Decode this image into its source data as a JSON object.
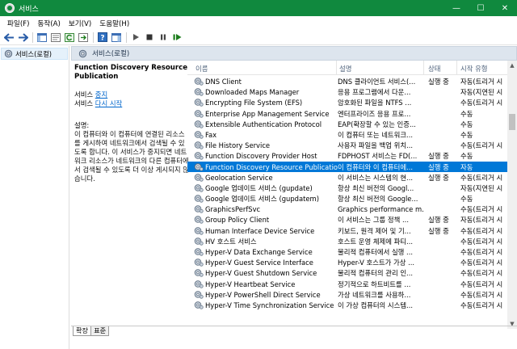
{
  "window": {
    "title": "서비스",
    "minimize": "—",
    "maximize": "☐",
    "close": "✕"
  },
  "menu": [
    "파일(F)",
    "동작(A)",
    "보기(V)",
    "도움말(H)"
  ],
  "tree": {
    "label": "서비스(로컬)"
  },
  "panel_header": "서비스(로컬)",
  "detail": {
    "title": "Function Discovery Resource Publication",
    "link_prefix_1": "서비스 ",
    "link_1": "중지",
    "link_prefix_2": "서비스 ",
    "link_2": "다시 시작",
    "desc_label": "설명:",
    "desc_text": "이 컴퓨터와 이 컴퓨터에 연결된 리소스를 게시하여 네트워크에서 검색될 수 있도록 합니다. 이 서비스가 중지되면 네트워크 리소스가 네트워크의 다른 컴퓨터에서 검색될 수 있도록 더 이상 게시되지 않습니다."
  },
  "columns": {
    "name": "이름",
    "desc": "설명",
    "status": "상태",
    "startup": "시작 유형"
  },
  "rows": [
    {
      "name": "DNS Client",
      "desc": "DNS 클라이언트 서비스(...",
      "status": "실행 중",
      "startup": "자동(트리거 시"
    },
    {
      "name": "Downloaded Maps Manager",
      "desc": "응용 프로그램에서 다운...",
      "status": "",
      "startup": "자동(지연된 시"
    },
    {
      "name": "Encrypting File System (EFS)",
      "desc": "암호화된 파일을 NTFS ...",
      "status": "",
      "startup": "수동(트리거 시"
    },
    {
      "name": "Enterprise App Management Service",
      "desc": "엔터프라이즈 응용 프로...",
      "status": "",
      "startup": "수동"
    },
    {
      "name": "Extensible Authentication Protocol",
      "desc": "EAP(확장할 수 있는 인증...",
      "status": "",
      "startup": "수동"
    },
    {
      "name": "Fax",
      "desc": "이 컴퓨터 또는 네트워크...",
      "status": "",
      "startup": "수동"
    },
    {
      "name": "File History Service",
      "desc": "사용자 파일을 백업 위치...",
      "status": "",
      "startup": "수동(트리거 시"
    },
    {
      "name": "Function Discovery Provider Host",
      "desc": "FDPHOST 서비스는 FD(...",
      "status": "실행 중",
      "startup": "수동"
    },
    {
      "name": "Function Discovery Resource Publication",
      "desc": "이 컴퓨터와 이 컴퓨터에...",
      "status": "실행 중",
      "startup": "자동"
    },
    {
      "name": "Geolocation Service",
      "desc": "이 서비스는 시스템의 현...",
      "status": "실행 중",
      "startup": "수동(트리거 시"
    },
    {
      "name": "Google 업데이트 서비스 (gupdate)",
      "desc": "항상 최신 버전의 Googl...",
      "status": "",
      "startup": "자동(지연된 시"
    },
    {
      "name": "Google 업데이트 서비스 (gupdatem)",
      "desc": "항상 최신 버전의 Google...",
      "status": "",
      "startup": "수동"
    },
    {
      "name": "GraphicsPerfSvc",
      "desc": "Graphics performance m...",
      "status": "",
      "startup": "수동(트리거 시"
    },
    {
      "name": "Group Policy Client",
      "desc": "이 서비스는 그룹 정책 ...",
      "status": "실행 중",
      "startup": "자동(트리거 시"
    },
    {
      "name": "Human Interface Device Service",
      "desc": "키보드, 원격 제어 및 기...",
      "status": "실행 중",
      "startup": "수동(트리거 시"
    },
    {
      "name": "HV 호스트 서비스",
      "desc": "호스트 운영 체제에 파티...",
      "status": "",
      "startup": "수동(트리거 시"
    },
    {
      "name": "Hyper-V Data Exchange Service",
      "desc": "물리적 컴퓨터에서 실행 ...",
      "status": "",
      "startup": "수동(트리거 시"
    },
    {
      "name": "Hyper-V Guest Service Interface",
      "desc": "Hyper-V 호스트가 가상 ...",
      "status": "",
      "startup": "수동(트리거 시"
    },
    {
      "name": "Hyper-V Guest Shutdown Service",
      "desc": "물리적 컴퓨터의 관리 인...",
      "status": "",
      "startup": "수동(트리거 시"
    },
    {
      "name": "Hyper-V Heartbeat Service",
      "desc": "정기적으로 하트비트를 ...",
      "status": "",
      "startup": "수동(트리거 시"
    },
    {
      "name": "Hyper-V PowerShell Direct Service",
      "desc": "가상 네트워크를 사용하...",
      "status": "",
      "startup": "수동(트리거 시"
    },
    {
      "name": "Hyper-V Time Synchronization Service",
      "desc": "이 가상 컴퓨터의 시스템...",
      "status": "",
      "startup": "수동(트리거 시"
    }
  ],
  "selected_index": 8,
  "tabs": {
    "extended": "확장",
    "standard": "표준"
  },
  "colors": {
    "titlebar": "#10893e",
    "selection": "#0078d7",
    "link": "#0066cc"
  }
}
